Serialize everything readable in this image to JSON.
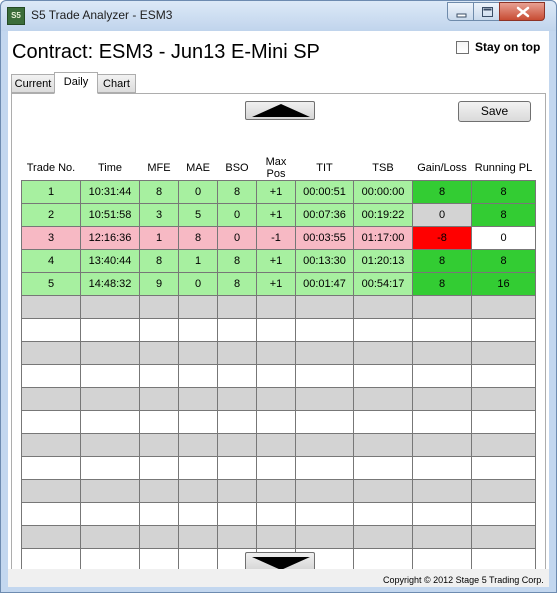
{
  "window": {
    "title": "S5 Trade Analyzer - ESM3",
    "app_icon_text": "S5"
  },
  "header": {
    "contract": "Contract: ESM3 - Jun13 E-Mini SP",
    "stay_on_top_label": "Stay on top",
    "stay_on_top_checked": false
  },
  "tabs": [
    {
      "label": "Current",
      "active": false
    },
    {
      "label": "Daily",
      "active": true
    },
    {
      "label": "Chart",
      "active": false
    }
  ],
  "toolbar": {
    "save_label": "Save",
    "scroll_up_icon": "triangle-up-icon",
    "scroll_down_icon": "triangle-down-icon"
  },
  "table": {
    "columns": [
      "Trade No.",
      "Time",
      "MFE",
      "MAE",
      "BSO",
      "Max Pos",
      "TIT",
      "TSB",
      "Gain/Loss",
      "Running PL"
    ],
    "rows": [
      {
        "trade_no": "1",
        "time": "10:31:44",
        "mfe": "8",
        "mae": "0",
        "bso": "8",
        "max_pos": "+1",
        "tit": "00:00:51",
        "tsb": "00:00:00",
        "gain_loss": "8",
        "running_pl": "8",
        "row_status": "win",
        "gl_status": "win",
        "pl_status": "positive"
      },
      {
        "trade_no": "2",
        "time": "10:51:58",
        "mfe": "3",
        "mae": "5",
        "bso": "0",
        "max_pos": "+1",
        "tit": "00:07:36",
        "tsb": "00:19:22",
        "gain_loss": "0",
        "running_pl": "8",
        "row_status": "win",
        "gl_status": "flat",
        "pl_status": "positive"
      },
      {
        "trade_no": "3",
        "time": "12:16:36",
        "mfe": "1",
        "mae": "8",
        "bso": "0",
        "max_pos": "-1",
        "tit": "00:03:55",
        "tsb": "01:17:00",
        "gain_loss": "-8",
        "running_pl": "0",
        "row_status": "loss",
        "gl_status": "loss",
        "pl_status": "zero"
      },
      {
        "trade_no": "4",
        "time": "13:40:44",
        "mfe": "8",
        "mae": "1",
        "bso": "8",
        "max_pos": "+1",
        "tit": "00:13:30",
        "tsb": "01:20:13",
        "gain_loss": "8",
        "running_pl": "8",
        "row_status": "win",
        "gl_status": "win",
        "pl_status": "positive"
      },
      {
        "trade_no": "5",
        "time": "14:48:32",
        "mfe": "9",
        "mae": "0",
        "bso": "8",
        "max_pos": "+1",
        "tit": "00:01:47",
        "tsb": "00:54:17",
        "gain_loss": "8",
        "running_pl": "16",
        "row_status": "win",
        "gl_status": "win",
        "pl_status": "positive"
      }
    ],
    "empty_row_count": 12
  },
  "colors": {
    "row_win": "#a7f0a0",
    "row_loss": "#f7b9c4",
    "gl_win": "#33cc33",
    "gl_flat": "#d3d3d3",
    "gl_loss": "#ff0000",
    "pl_positive": "#33cc33",
    "pl_zero": "#ffffff",
    "empty_gray": "#d3d3d3",
    "empty_white": "#ffffff"
  },
  "footer": {
    "copyright": "Copyright © 2012 Stage 5 Trading Corp."
  }
}
